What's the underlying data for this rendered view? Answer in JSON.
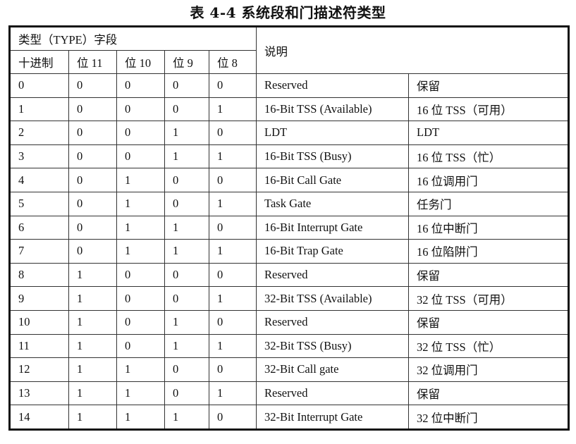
{
  "caption": "表 4-4 系统段和门描述符类型",
  "header": {
    "type_group": "类型（TYPE）字段",
    "explain": "说明",
    "columns": [
      "十进制",
      "位 11",
      "位 10",
      "位 9",
      "位 8"
    ]
  },
  "rows": [
    {
      "dec": "0",
      "b11": "0",
      "b10": "0",
      "b9": "0",
      "b8": "0",
      "en": "Reserved",
      "zh": "保留"
    },
    {
      "dec": "1",
      "b11": "0",
      "b10": "0",
      "b9": "0",
      "b8": "1",
      "en": "16-Bit TSS (Available)",
      "zh": "16 位  TSS（可用）"
    },
    {
      "dec": "2",
      "b11": "0",
      "b10": "0",
      "b9": "1",
      "b8": "0",
      "en": "LDT",
      "zh": "LDT"
    },
    {
      "dec": "3",
      "b11": "0",
      "b10": "0",
      "b9": "1",
      "b8": "1",
      "en": "16-Bit TSS (Busy)",
      "zh": "16 位  TSS（忙）"
    },
    {
      "dec": "4",
      "b11": "0",
      "b10": "1",
      "b9": "0",
      "b8": "0",
      "en": "16-Bit Call Gate",
      "zh": "16 位调用门"
    },
    {
      "dec": "5",
      "b11": "0",
      "b10": "1",
      "b9": "0",
      "b8": "1",
      "en": "Task Gate",
      "zh": "任务门"
    },
    {
      "dec": "6",
      "b11": "0",
      "b10": "1",
      "b9": "1",
      "b8": "0",
      "en": "16-Bit Interrupt Gate",
      "zh": "16 位中断门"
    },
    {
      "dec": "7",
      "b11": "0",
      "b10": "1",
      "b9": "1",
      "b8": "1",
      "en": "16-Bit Trap Gate",
      "zh": "16 位陷阱门"
    },
    {
      "dec": "8",
      "b11": "1",
      "b10": "0",
      "b9": "0",
      "b8": "0",
      "en": "Reserved",
      "zh": "保留"
    },
    {
      "dec": "9",
      "b11": "1",
      "b10": "0",
      "b9": "0",
      "b8": "1",
      "en": "32-Bit TSS (Available)",
      "zh": "32 位 TSS（可用）"
    },
    {
      "dec": "10",
      "b11": "1",
      "b10": "0",
      "b9": "1",
      "b8": "0",
      "en": "Reserved",
      "zh": "保留"
    },
    {
      "dec": "11",
      "b11": "1",
      "b10": "0",
      "b9": "1",
      "b8": "1",
      "en": "32-Bit TSS (Busy)",
      "zh": "32 位 TSS（忙）"
    },
    {
      "dec": "12",
      "b11": "1",
      "b10": "1",
      "b9": "0",
      "b8": "0",
      "en": "32-Bit Call gate",
      "zh": "32 位调用门"
    },
    {
      "dec": "13",
      "b11": "1",
      "b10": "1",
      "b9": "0",
      "b8": "1",
      "en": "Reserved",
      "zh": "保留"
    },
    {
      "dec": "14",
      "b11": "1",
      "b10": "1",
      "b9": "1",
      "b8": "0",
      "en": "32-Bit Interrupt Gate",
      "zh": "32 位中断门"
    }
  ]
}
